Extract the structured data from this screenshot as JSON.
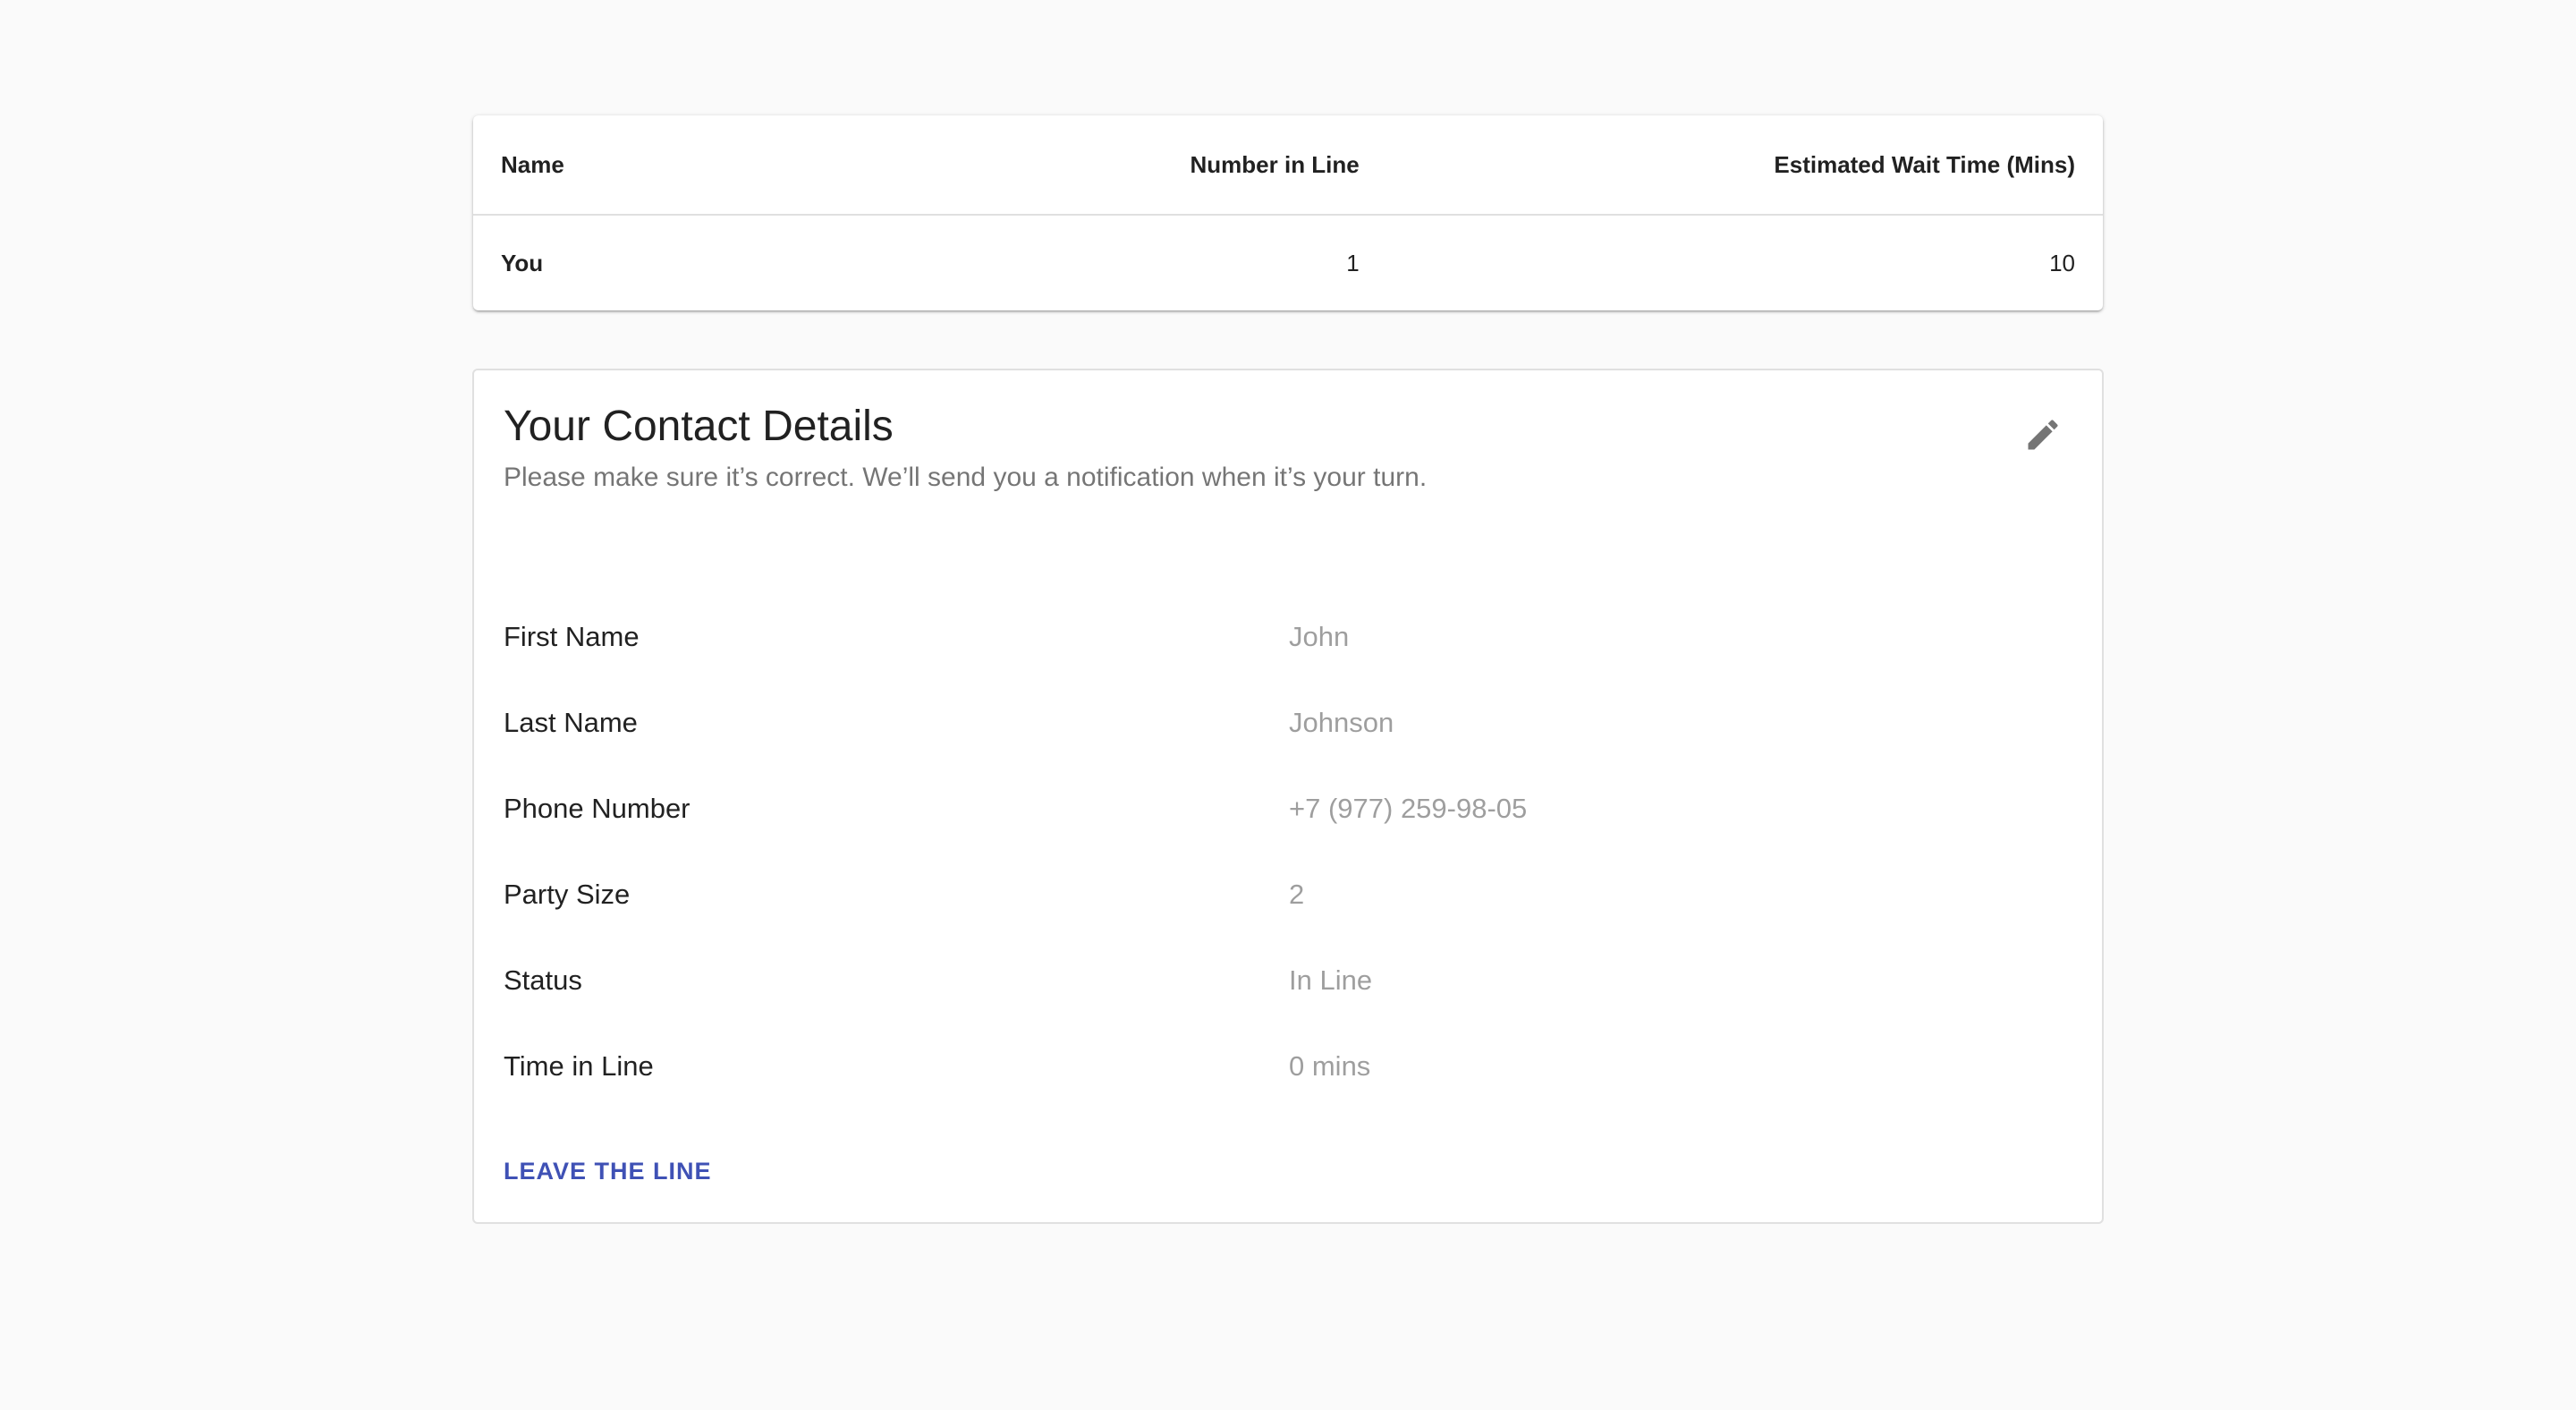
{
  "queue_table": {
    "headers": [
      "Name",
      "Number in Line",
      "Estimated Wait Time (Mins)"
    ],
    "rows": [
      {
        "name": "You",
        "number": "1",
        "wait": "10"
      }
    ]
  },
  "contact": {
    "title": "Your Contact Details",
    "subtitle": "Please make sure it’s correct. We’ll send you a notification when it’s your turn.",
    "edit_icon": "pencil-icon",
    "details": [
      {
        "label": "First Name",
        "value": "John"
      },
      {
        "label": "Last Name",
        "value": "Johnson"
      },
      {
        "label": "Phone Number",
        "value": "+7 (977) 259-98-05"
      },
      {
        "label": "Party Size",
        "value": "2"
      },
      {
        "label": "Status",
        "value": "In Line"
      },
      {
        "label": "Time in Line",
        "value": "0 mins"
      }
    ],
    "leave_label": "LEAVE THE LINE"
  },
  "colors": {
    "accent": "#3f51b5",
    "background": "#fafafa",
    "icon": "#757575"
  }
}
